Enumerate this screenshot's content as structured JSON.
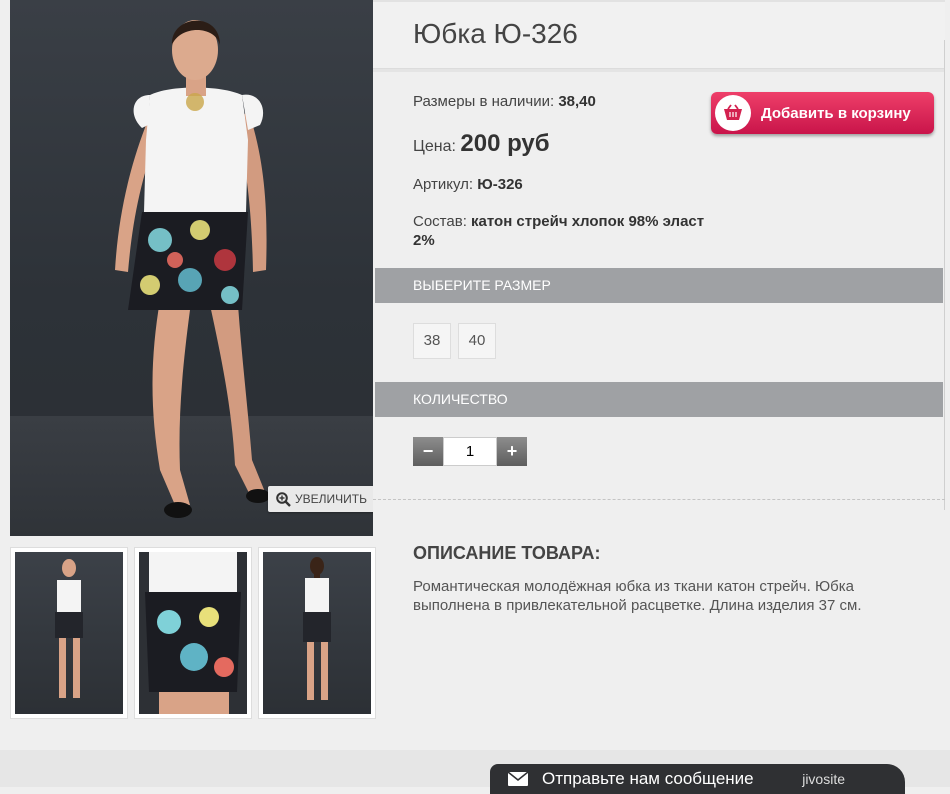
{
  "product": {
    "title": "Юбка Ю-326",
    "sizes_label": "Размеры в наличии:",
    "sizes_value": "38,40",
    "price_label": "Цена:",
    "price_value": "200 руб",
    "article_label": "Артикул:",
    "article_value": "Ю-326",
    "composition_label": "Состав:",
    "composition_value": "катон стрейч хлопок 98% эласт 2%"
  },
  "gallery": {
    "zoom_label": "УВЕЛИЧИТЬ"
  },
  "cart": {
    "add_label": "Добавить в корзину",
    "accent": "#e3275a"
  },
  "size_section": {
    "header": "ВЫБЕРИТЕ РАЗМЕР",
    "options": [
      "38",
      "40"
    ]
  },
  "quantity_section": {
    "header": "КОЛИЧЕСТВО",
    "minus": "−",
    "plus": "+",
    "value": "1"
  },
  "description": {
    "title": "ОПИСАНИЕ ТОВАРА:",
    "text": "Романтическая молодёжная юбка из ткани катон стрейч. Юбка выполнена в привлекательной расцветке. Длина изделия 37 см."
  },
  "footer": {
    "message_label": "Отправьте нам сообщение",
    "brand": "jivosite"
  }
}
